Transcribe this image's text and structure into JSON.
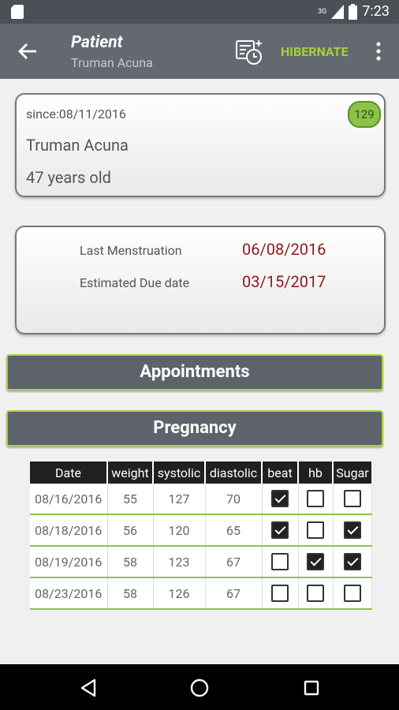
{
  "status_bar": {
    "time": "7:23",
    "signal_label": "3G"
  },
  "app_bar": {
    "title": "Patient",
    "subtitle": "Truman Acuna",
    "action_label": "HIBERNATE"
  },
  "patient_card": {
    "since": "since:08/11/2016",
    "badge": "129",
    "name": "Truman Acuna",
    "age": "47 years old"
  },
  "dates_card": {
    "last_menstruation_label": "Last Menstruation",
    "last_menstruation_value": "06/08/2016",
    "due_date_label": "Estimated Due date",
    "due_date_value": "03/15/2017"
  },
  "sections": {
    "appointments": "Appointments",
    "pregnancy": "Pregnancy"
  },
  "table": {
    "headers": [
      "Date",
      "weight",
      "systolic",
      "diastolic",
      "beat",
      "hb",
      "Sugar"
    ],
    "rows": [
      {
        "date": "08/16/2016",
        "weight": "55",
        "systolic": "127",
        "diastolic": "70",
        "beat": true,
        "hb": false,
        "sugar": false
      },
      {
        "date": "08/18/2016",
        "weight": "56",
        "systolic": "120",
        "diastolic": "65",
        "beat": true,
        "hb": false,
        "sugar": true
      },
      {
        "date": "08/19/2016",
        "weight": "58",
        "systolic": "123",
        "diastolic": "67",
        "beat": false,
        "hb": true,
        "sugar": true
      },
      {
        "date": "08/23/2016",
        "weight": "58",
        "systolic": "126",
        "diastolic": "67",
        "beat": false,
        "hb": false,
        "sugar": false
      }
    ]
  },
  "colors": {
    "accent": "#a7d13a",
    "appbar": "#646971",
    "date_value": "#8b1a1a"
  }
}
